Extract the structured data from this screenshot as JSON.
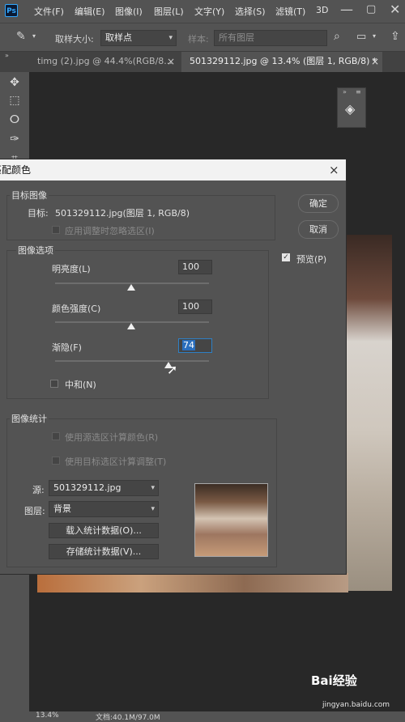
{
  "menubar": {
    "app_icon": "Ps",
    "items": [
      "文件(F)",
      "编辑(E)",
      "图像(I)",
      "图层(L)",
      "文字(Y)",
      "选择(S)",
      "滤镜(T)",
      "3D"
    ]
  },
  "options": {
    "sample_size_label": "取样大小:",
    "sample_size_value": "取样点",
    "sample_label": "样本:",
    "sample_value": "所有图层"
  },
  "tabs": [
    {
      "label": "timg (2).jpg @ 44.4%(RGB/8...",
      "close": "×"
    },
    {
      "label": "501329112.jpg @ 13.4% (图层 1, RGB/8) *",
      "close": "×"
    }
  ],
  "dialog": {
    "title": "匹配颜色",
    "close": "×",
    "target_group": "目标图像",
    "target_label": "目标:",
    "target_value": "501329112.jpg(图层 1, RGB/8)",
    "ignore_selection": "应用调整时忽略选区(I)",
    "options_group": "图像选项",
    "luminance_label": "明亮度(L)",
    "luminance_value": "100",
    "color_intensity_label": "颜色强度(C)",
    "color_intensity_value": "100",
    "fade_label": "渐隐(F)",
    "fade_value": "74",
    "neutralize_label": "中和(N)",
    "stats_group": "图像统计",
    "use_source_selection": "使用源选区计算颜色(R)",
    "use_target_selection": "使用目标选区计算调整(T)",
    "source_label": "源:",
    "source_value": "501329112.jpg",
    "layer_label": "图层:",
    "layer_value": "背景",
    "load_stats": "载入统计数据(O)...",
    "save_stats": "存储统计数据(V)...",
    "ok": "确定",
    "cancel": "取消",
    "preview": "预览(P)",
    "preview_checked": true
  },
  "status": {
    "zoom": "13.4%",
    "doc": "文档:40.1M/97.0M"
  },
  "watermark": {
    "brand": "Bai经验",
    "url": "jingyan.baidu.com"
  }
}
